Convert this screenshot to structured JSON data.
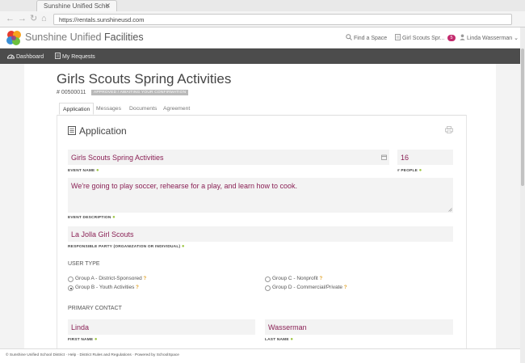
{
  "browser": {
    "tab_title": "Sunshine Unified Scho",
    "tab_close": "✕",
    "url": "https://rentals.sunshineusd.com"
  },
  "header": {
    "brand_light": "Sunshine Unified",
    "brand_bold": "Facilities",
    "find_space": "Find a Space",
    "cart_label": "Girl Scouts Spr...",
    "cart_count": "5",
    "user_name": "Linda Wasserman"
  },
  "nav": {
    "dashboard": "Dashboard",
    "my_requests": "My Requests"
  },
  "request": {
    "title": "Girls Scouts Spring Activities",
    "number": "# 00500011",
    "status": "APPROVED / AWAITING YOUR CONFIRMATION"
  },
  "tabs": [
    "Application",
    "Messages",
    "Documents",
    "Agreement"
  ],
  "application": {
    "section_title": "Application",
    "event_name": {
      "value": "Girls Scouts Spring Activities",
      "label": "EVENT NAME"
    },
    "people": {
      "value": "16",
      "label": "# PEOPLE"
    },
    "event_description": {
      "value": "We're going to play soccer, rehearse for a play, and learn how to cook.",
      "label": "EVENT DESCRIPTION"
    },
    "responsible_party": {
      "value": "La Jolla Girl Scouts",
      "label": "RESPONSIBLE PARTY (ORGANIZATION OR INDIVIDUAL)"
    },
    "user_type": {
      "heading": "USER TYPE",
      "options": [
        {
          "label": "Group A - District-Sponsored",
          "checked": false
        },
        {
          "label": "Group B - Youth Activities",
          "checked": true
        },
        {
          "label": "Group C - Nonprofit",
          "checked": false
        },
        {
          "label": "Group D - Commercial/Private",
          "checked": false
        }
      ]
    },
    "primary_contact": {
      "heading": "PRIMARY CONTACT",
      "first_name": {
        "value": "Linda",
        "label": "FIRST NAME"
      },
      "last_name": {
        "value": "Wasserman",
        "label": "LAST NAME"
      }
    }
  },
  "footer": {
    "text": "© Sunshine Unified School District · Help · District Rules and Regulations · Powered by SchoolSpace"
  },
  "colors": {
    "accent": "#8a2155",
    "badge": "#c32a6d",
    "required": "#9bc43f",
    "help": "#e1a32a",
    "nav_bg": "#4c4c4c"
  }
}
